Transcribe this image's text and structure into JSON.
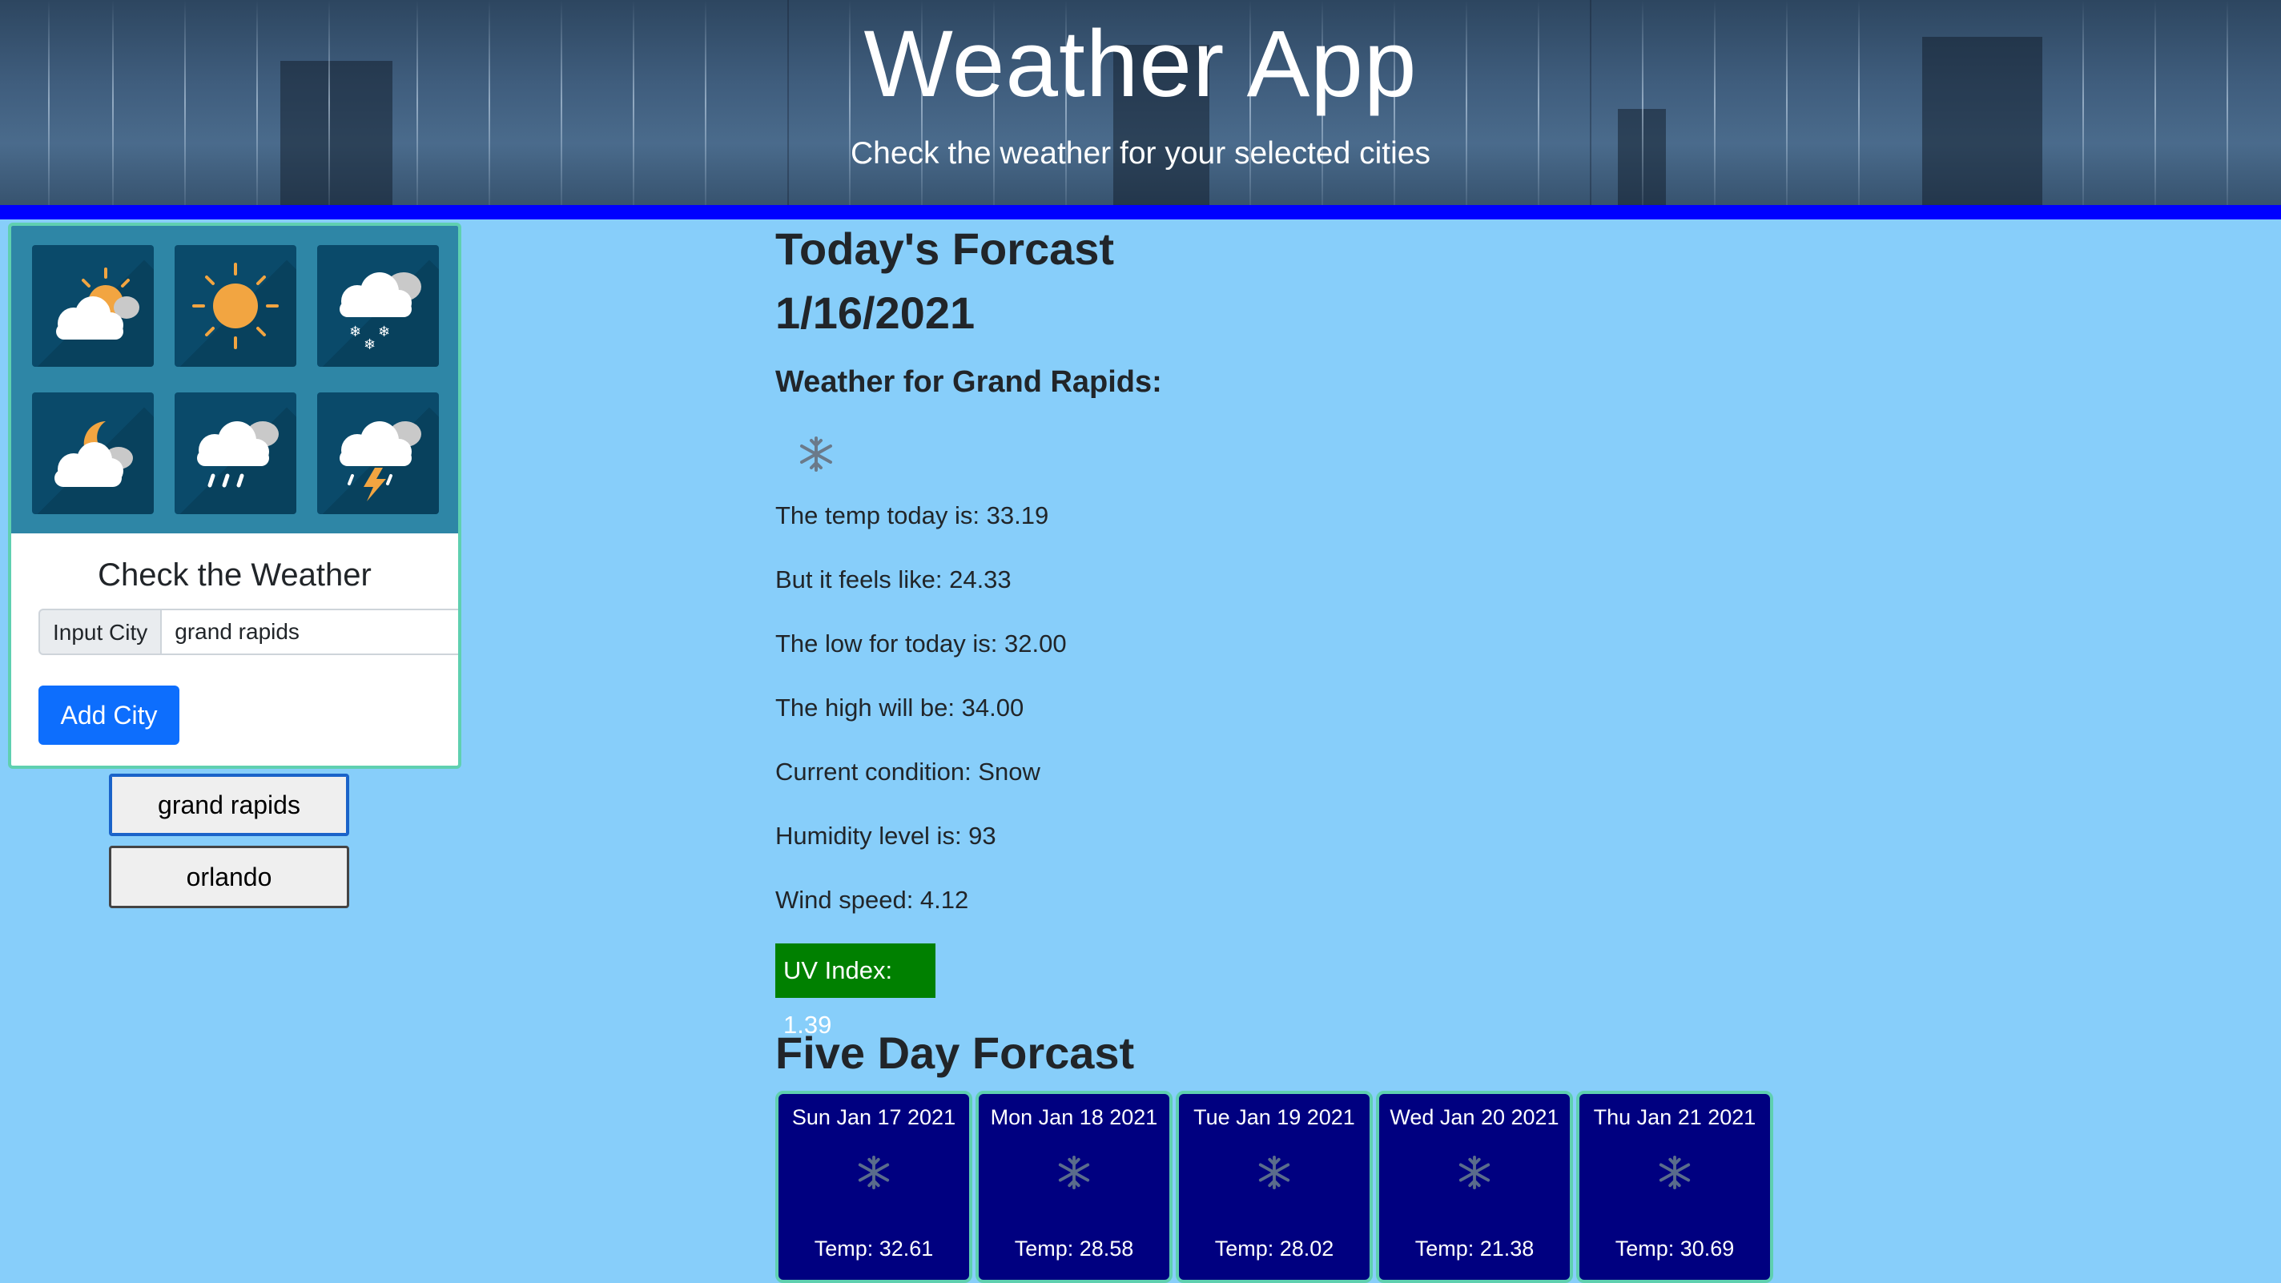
{
  "header": {
    "title": "Weather App",
    "subtitle": "Check the weather for your selected cities"
  },
  "search_card": {
    "weather_icons": [
      "partly-sunny-icon",
      "sun-icon",
      "snow-cloud-icon",
      "night-cloud-icon",
      "rain-cloud-icon",
      "thunderstorm-icon"
    ],
    "title": "Check the Weather",
    "input_label": "Input City",
    "input_value": "grand rapids",
    "add_button": "Add City"
  },
  "saved_cities": [
    "grand rapids",
    "orlando"
  ],
  "today": {
    "heading": "Today's Forcast",
    "date": "1/16/2021",
    "location": "Weather for Grand Rapids:",
    "icon": "snowflake-icon",
    "temp": "The temp today is: 33.19",
    "feels_like": "But it feels like: 24.33",
    "low": "The low for today is: 32.00",
    "high": "The high will be: 34.00",
    "condition": "Current condition: Snow",
    "humidity": "Humidity level is: 93",
    "wind": "Wind speed: 4.12",
    "uv": "UV Index: 1.39",
    "uv_color": "#008000"
  },
  "five_day": {
    "heading": "Five Day Forcast",
    "days": [
      {
        "date": "Sun Jan 17 2021",
        "icon": "snowflake-icon",
        "temp": "Temp: 32.61"
      },
      {
        "date": "Mon Jan 18 2021",
        "icon": "snowflake-icon",
        "temp": "Temp: 28.58"
      },
      {
        "date": "Tue Jan 19 2021",
        "icon": "snowflake-icon",
        "temp": "Temp: 28.02"
      },
      {
        "date": "Wed Jan 20 2021",
        "icon": "snowflake-icon",
        "temp": "Temp: 21.38"
      },
      {
        "date": "Thu Jan 21 2021",
        "icon": "snowflake-icon",
        "temp": "Temp: 30.69"
      }
    ]
  },
  "colors": {
    "page_bg": "#87cefa",
    "header_bar": "#0000ff",
    "day_card_bg": "#000080",
    "button_primary": "#0d6efd"
  }
}
